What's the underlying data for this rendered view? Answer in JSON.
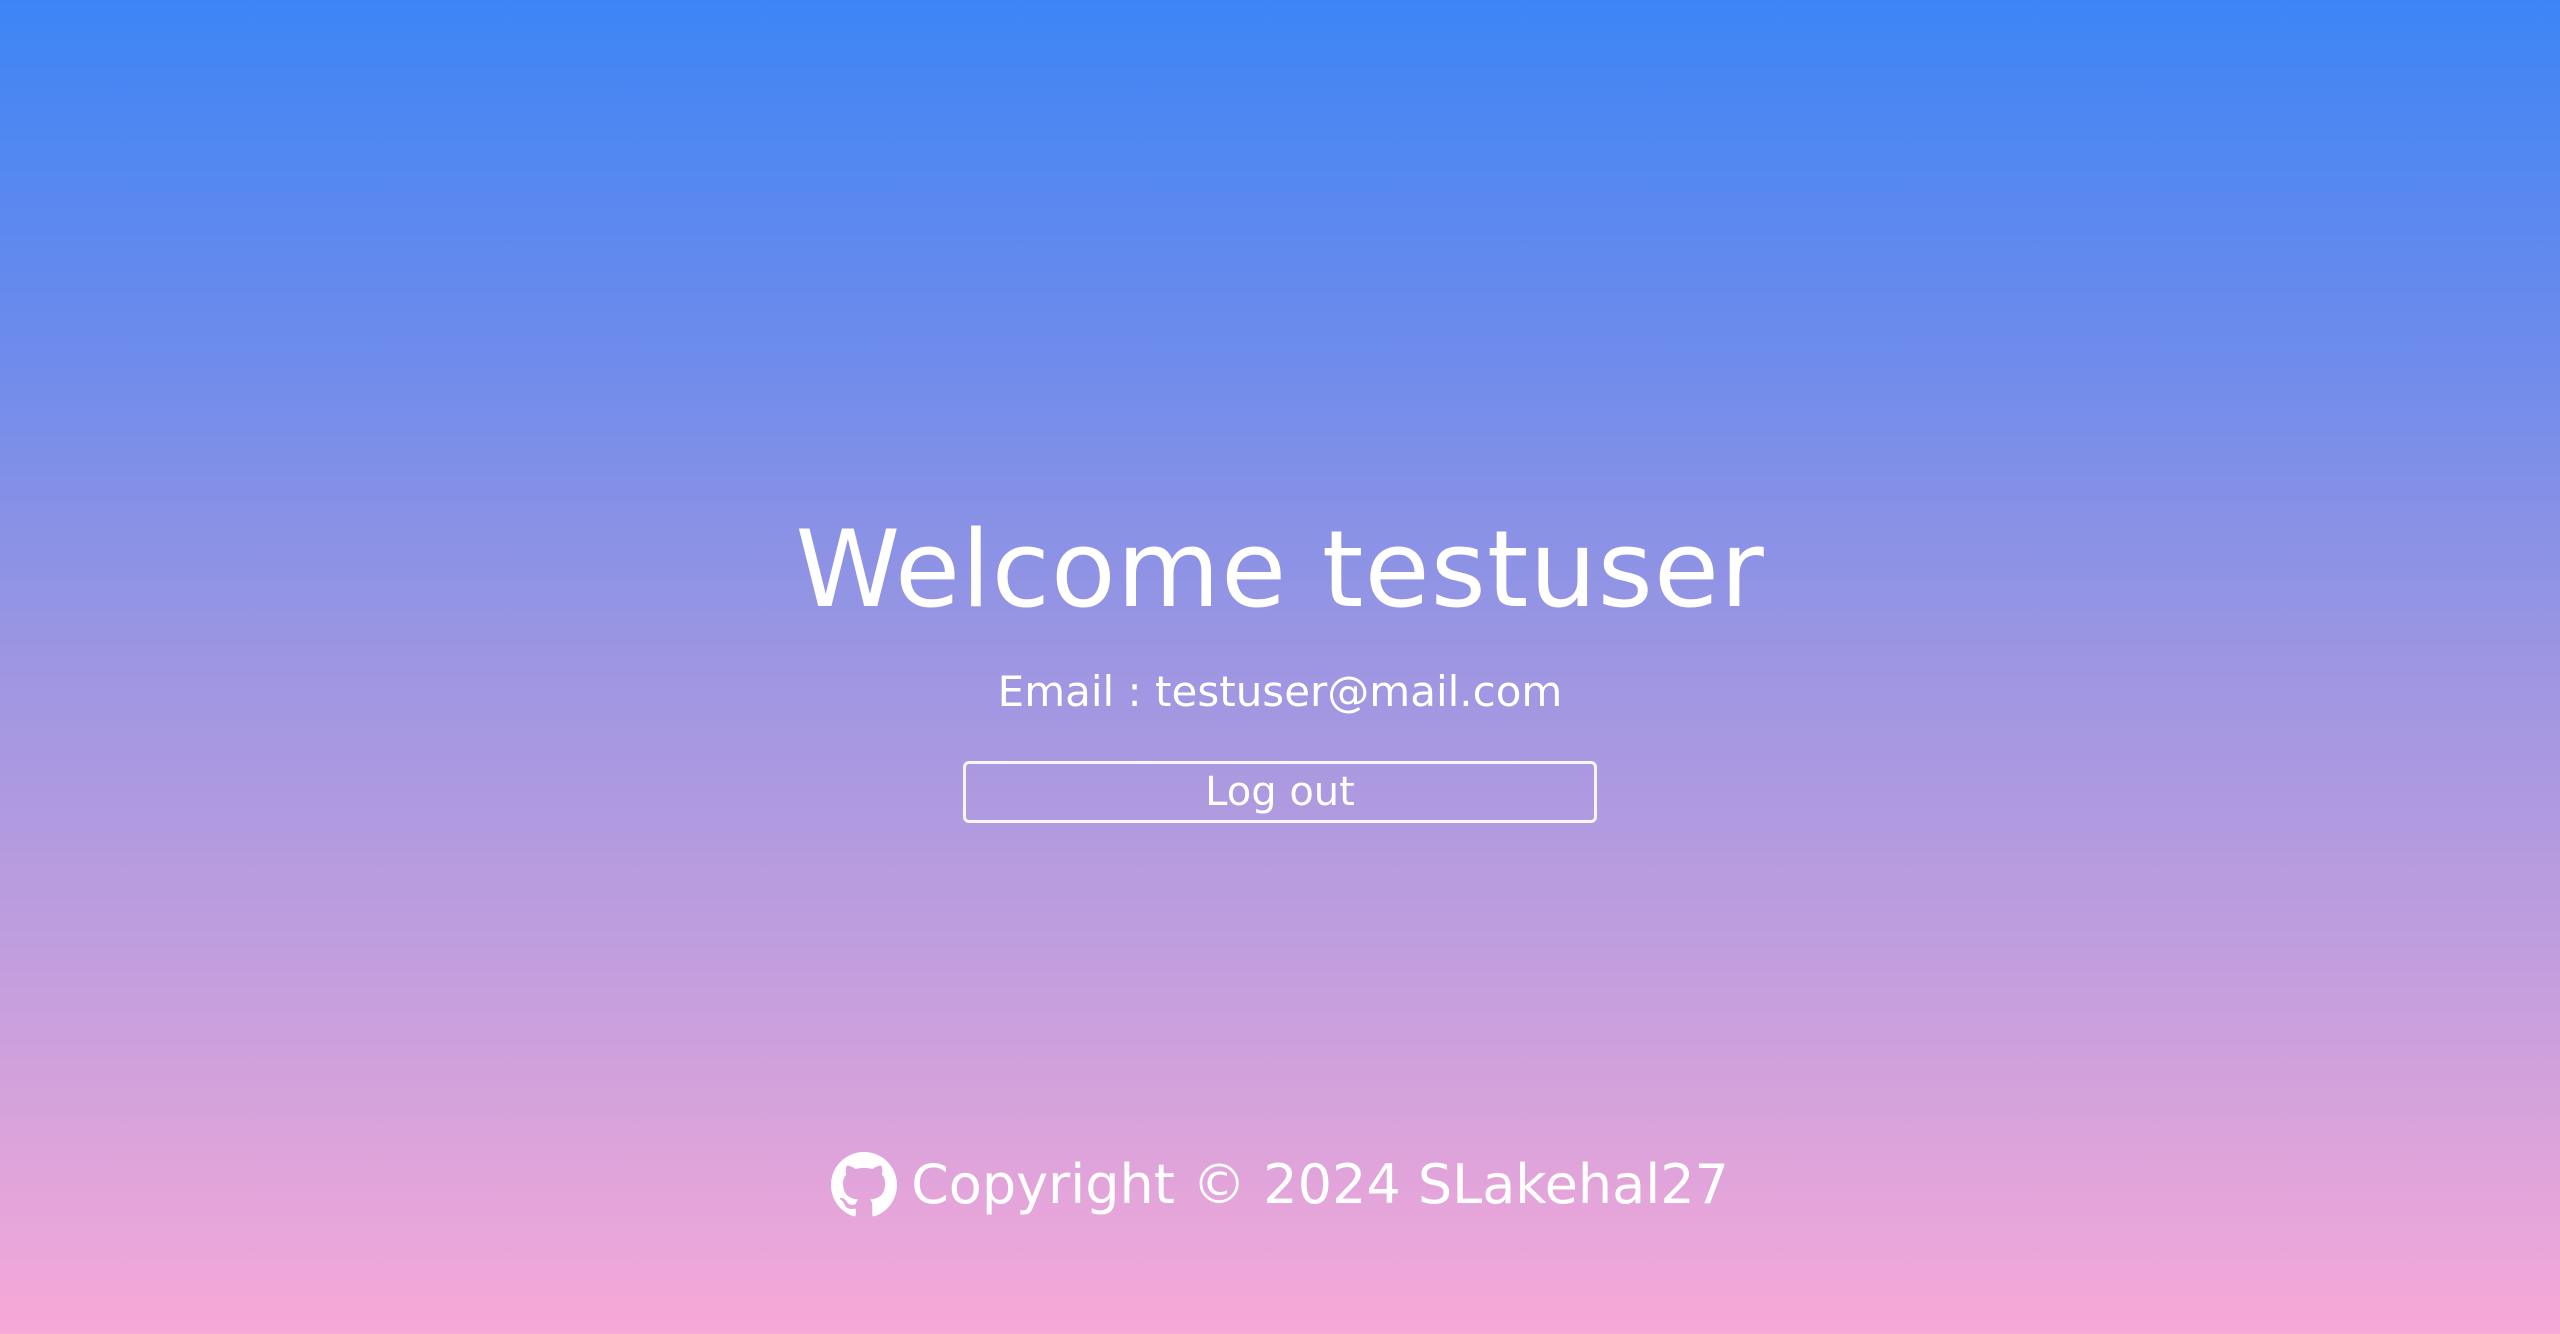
{
  "welcome": {
    "title": "Welcome testuser",
    "email_line": "Email : testuser@mail.com"
  },
  "actions": {
    "logout_label": "Log out"
  },
  "footer": {
    "icon": "github-icon",
    "text": "Copyright © 2024 SLakehal27"
  },
  "colors": {
    "gradient_top": "#3d85f6",
    "gradient_bottom": "#f7a9d8",
    "text": "#ffffff"
  }
}
